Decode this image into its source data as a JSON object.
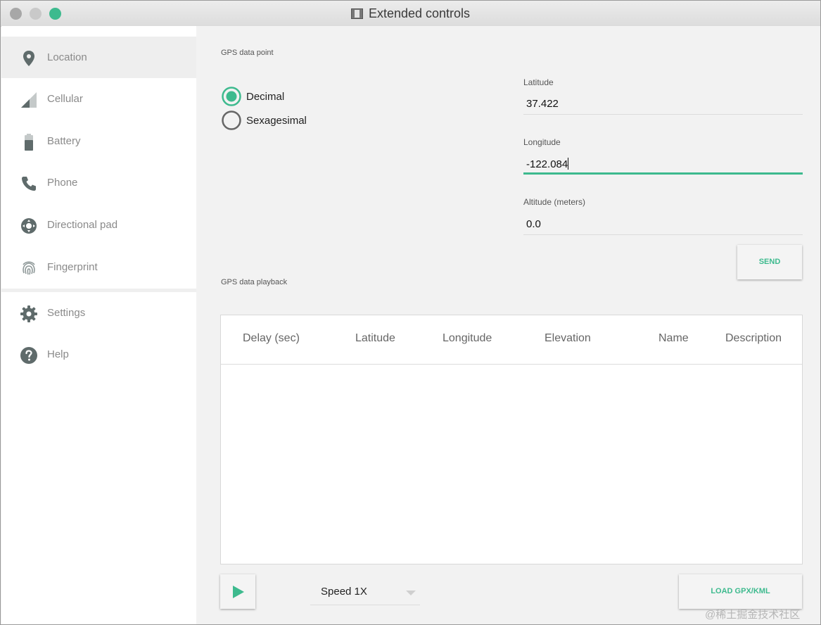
{
  "window": {
    "title": "Extended controls",
    "accent": "#3dba8e"
  },
  "sidebar": {
    "items": [
      {
        "label": "Location",
        "icon": "location-pin-icon"
      },
      {
        "label": "Cellular",
        "icon": "signal-icon"
      },
      {
        "label": "Battery",
        "icon": "battery-icon"
      },
      {
        "label": "Phone",
        "icon": "phone-icon"
      },
      {
        "label": "Directional pad",
        "icon": "dpad-icon"
      },
      {
        "label": "Fingerprint",
        "icon": "fingerprint-icon"
      },
      {
        "label": "Settings",
        "icon": "gear-icon"
      },
      {
        "label": "Help",
        "icon": "help-icon"
      }
    ]
  },
  "gps_point": {
    "section_label": "GPS data point",
    "radio_decimal": "Decimal",
    "radio_sexagesimal": "Sexagesimal",
    "selected": "Decimal",
    "latitude_label": "Latitude",
    "latitude_value": "37.422",
    "longitude_label": "Longitude",
    "longitude_value": "-122.084",
    "altitude_label": "Altitude (meters)",
    "altitude_value": "0.0",
    "send_label": "SEND"
  },
  "playback": {
    "section_label": "GPS data playback",
    "columns": [
      "Delay (sec)",
      "Latitude",
      "Longitude",
      "Elevation",
      "Name",
      "Description"
    ],
    "rows": [],
    "speed_label": "Speed 1X",
    "load_label": "LOAD GPX/KML"
  },
  "watermark": "@稀土掘金技术社区"
}
